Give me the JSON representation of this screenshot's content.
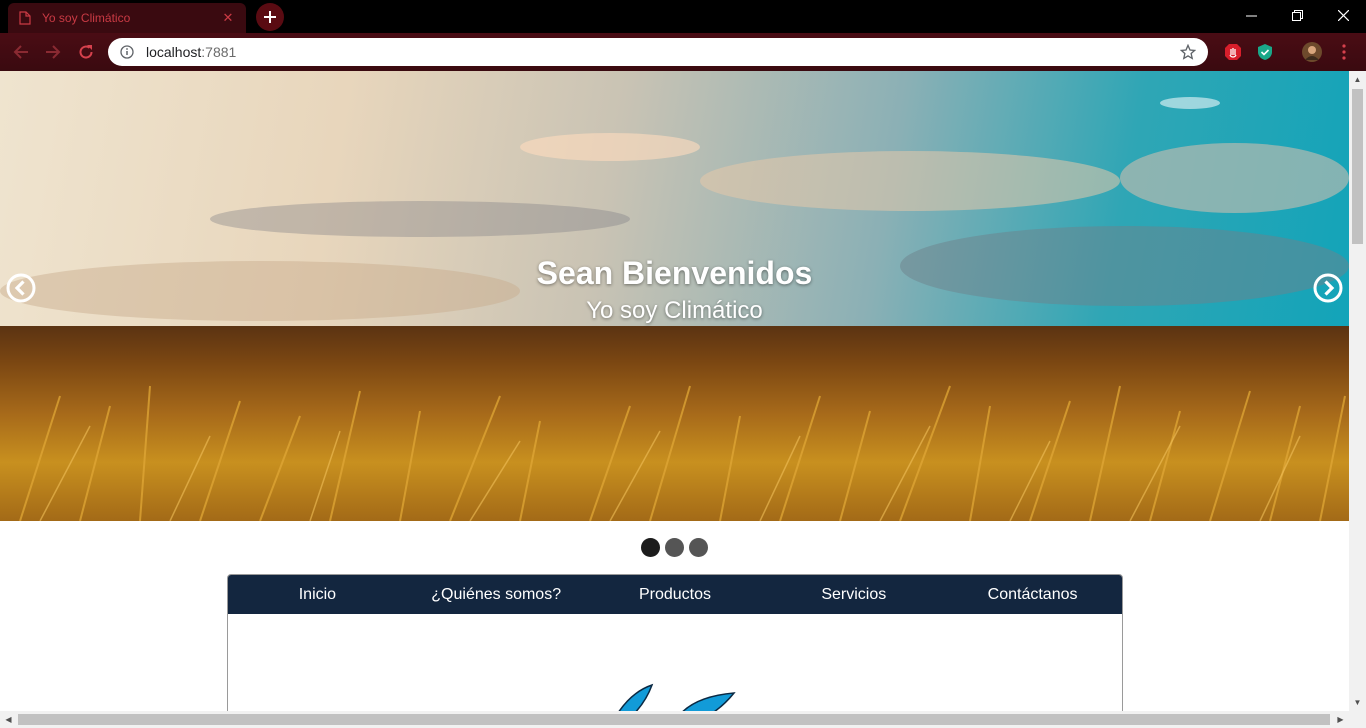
{
  "browser": {
    "tab": {
      "title": "Yo soy Climático",
      "favicon": "page-icon",
      "close_icon": "close-icon"
    },
    "new_tab_icon": "plus-icon",
    "window_controls": [
      "minimize-icon",
      "restore-icon",
      "close-icon"
    ],
    "nav": {
      "back": "arrow-left-icon",
      "forward": "arrow-right-icon",
      "reload": "reload-icon"
    },
    "address": {
      "security_icon": "info-icon",
      "host": "localhost",
      "port": ":7881",
      "bookmark_icon": "star-icon"
    },
    "extensions": [
      "hand-stop-extension-icon",
      "shield-check-extension-icon",
      "profile-avatar",
      "menu-kebab-icon"
    ],
    "colors": {
      "frame": "#000000",
      "toolbar": "#3a0a10",
      "accent": "#c93a44"
    }
  },
  "hero": {
    "title": "Sean Bienvenidos",
    "subtitle": "Yo soy Climático",
    "prev_icon": "chevron-left-circle-icon",
    "next_icon": "chevron-right-circle-icon",
    "slides": {
      "count": 3,
      "active": 1
    }
  },
  "nav_menu": {
    "items": [
      {
        "label": "Inicio"
      },
      {
        "label": "¿Quiénes somos?"
      },
      {
        "label": "Productos"
      },
      {
        "label": "Servicios"
      },
      {
        "label": "Contáctanos"
      }
    ],
    "background": "#13263f"
  },
  "logo": {
    "icon": "leaf-logo-icon",
    "color": "#129bd8"
  }
}
